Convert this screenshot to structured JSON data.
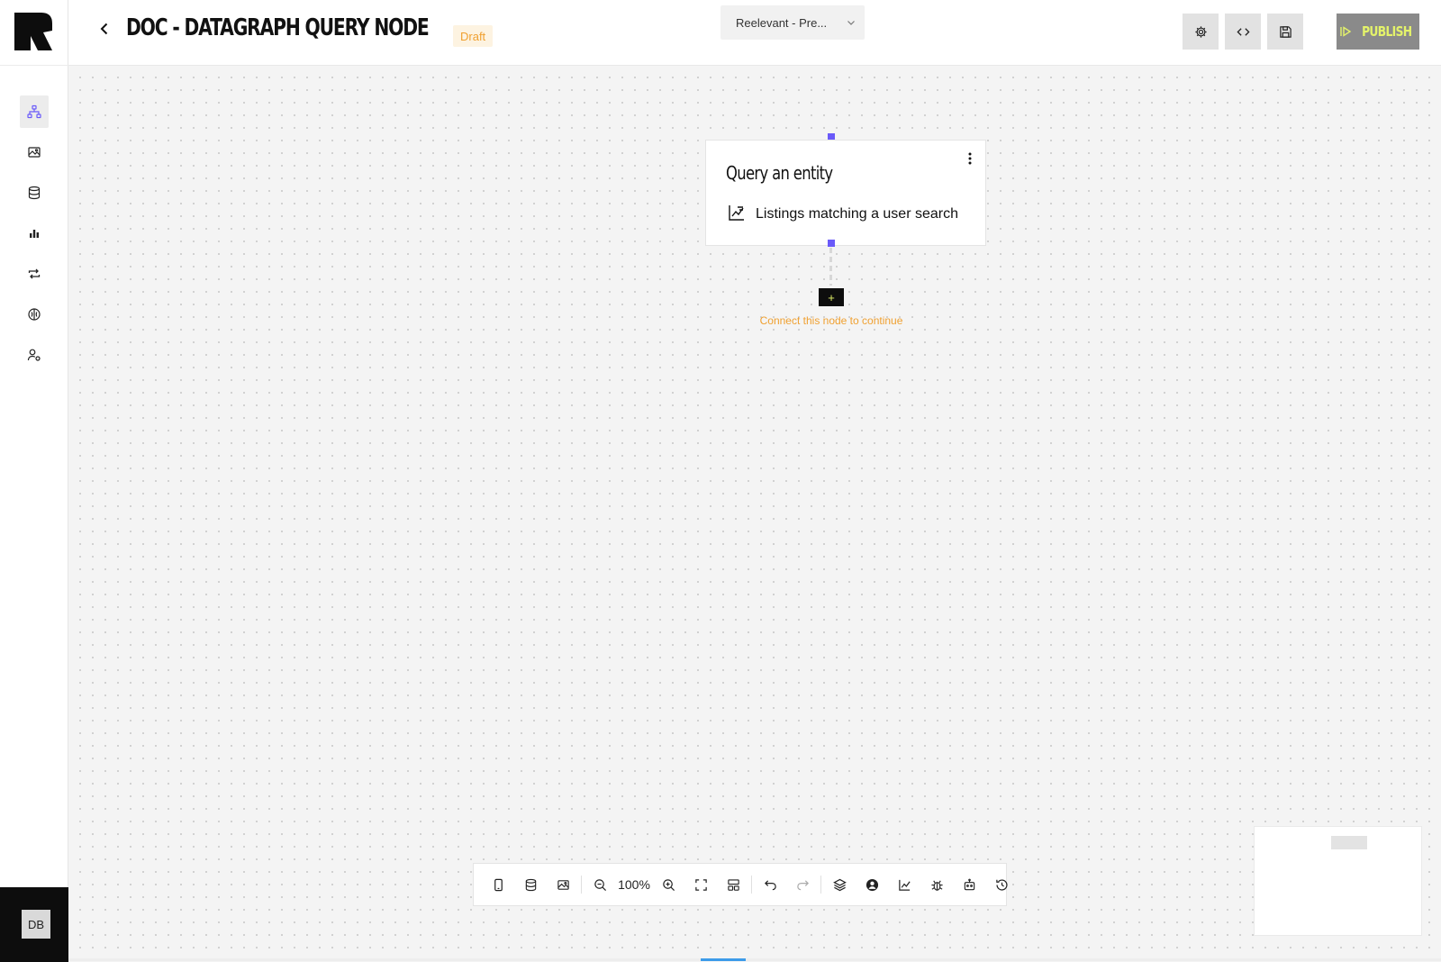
{
  "header": {
    "title": "DOC - DATAGRAPH QUERY NODE",
    "status": "Draft",
    "project_select": "Reelevant - Pre...",
    "publish_label": "PUBLISH"
  },
  "user": {
    "initials": "DB"
  },
  "node": {
    "title": "Query an entity",
    "subtitle": "Listings matching a user search",
    "connect_hint": "Connect this node to continue",
    "add_label": "+"
  },
  "toolbar": {
    "zoom_level": "100%"
  },
  "colors": {
    "accent": "#6a5af9",
    "warning": "#f0a030",
    "publish_text": "#e4f36a",
    "publish_bg": "#8a8a8a",
    "sidebar_footer": "#0d0d0d"
  }
}
